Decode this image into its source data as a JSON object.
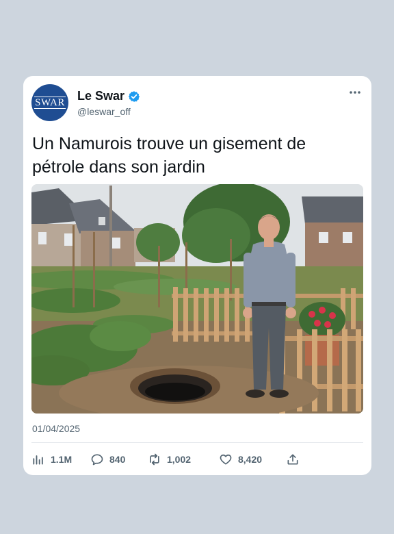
{
  "account": {
    "avatar_text": "SWAR",
    "avatar_color": "#1f4d92",
    "display_name": "Le Swar",
    "handle": "@leswar_off",
    "verified": true,
    "verified_color": "#1d9bf0"
  },
  "post": {
    "text": "Un Namurois trouve un gisement de pétrole dans son jardin",
    "date": "01/04/2025",
    "media_icon": "photo-of-man-in-garden-next-to-hole"
  },
  "stats": {
    "views": "1.1M",
    "replies": "840",
    "reposts": "1,002",
    "likes": "8,420"
  },
  "icons": {
    "more": "more-dots-icon",
    "views": "bar-chart-icon",
    "reply": "speech-bubble-icon",
    "repost": "repost-icon",
    "like": "heart-icon",
    "share": "share-icon"
  }
}
